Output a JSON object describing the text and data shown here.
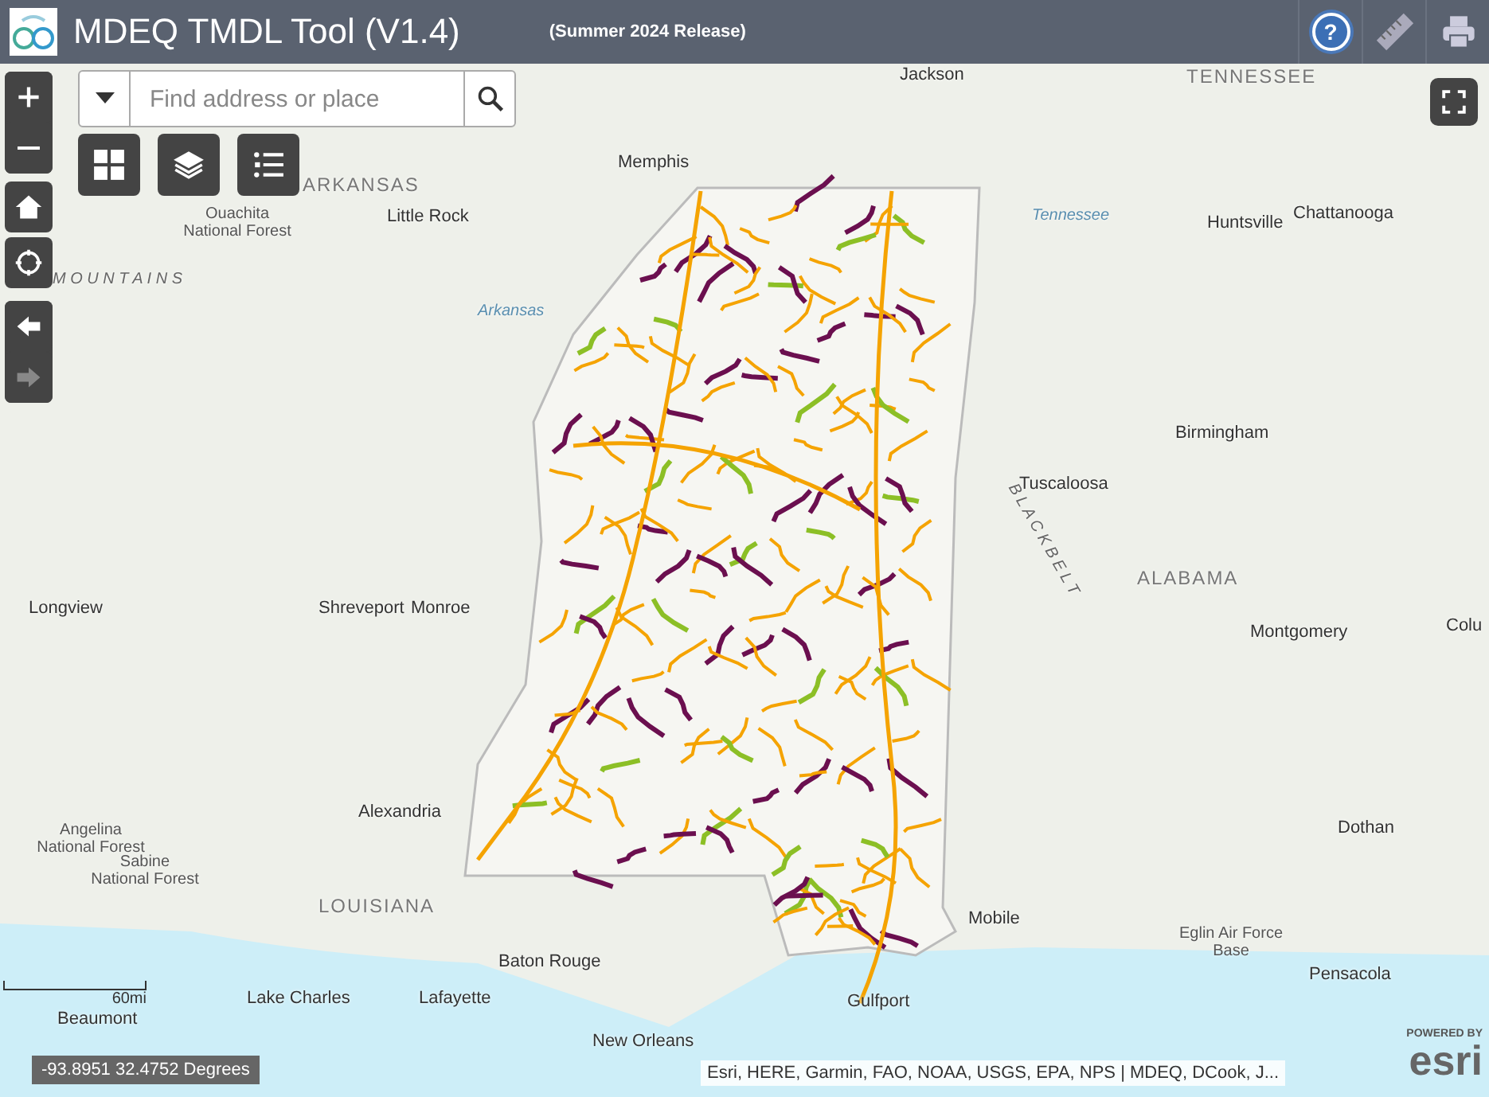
{
  "header": {
    "title": "MDEQ TMDL Tool (V1.4)",
    "subtitle": "(Summer 2024 Release)",
    "help_glyph": "?"
  },
  "search": {
    "placeholder": "Find address or place"
  },
  "map_labels": [
    {
      "text": "Jackson",
      "kind": "city"
    },
    {
      "text": "TENNESSEE",
      "kind": "state"
    },
    {
      "text": "Memphis",
      "kind": "city"
    },
    {
      "text": "ARKANSAS",
      "kind": "state"
    },
    {
      "text": "Ouachita National Forest",
      "kind": "park"
    },
    {
      "text": "Little Rock",
      "kind": "city"
    },
    {
      "text": "Tennessee",
      "kind": "water"
    },
    {
      "text": "Huntsville",
      "kind": "city"
    },
    {
      "text": "Chattanooga",
      "kind": "city"
    },
    {
      "text": "M O U N T A I N S",
      "kind": "region"
    },
    {
      "text": "Arkansas",
      "kind": "water"
    },
    {
      "text": "Birmingham",
      "kind": "city"
    },
    {
      "text": "Tuscaloosa",
      "kind": "city"
    },
    {
      "text": "B L A C K  B E L T",
      "kind": "region"
    },
    {
      "text": "ALABAMA",
      "kind": "state"
    },
    {
      "text": "Longview",
      "kind": "city"
    },
    {
      "text": "Shreveport",
      "kind": "city"
    },
    {
      "text": "Monroe",
      "kind": "city"
    },
    {
      "text": "Montgomery",
      "kind": "city"
    },
    {
      "text": "Colu",
      "kind": "city"
    },
    {
      "text": "Alexandria",
      "kind": "city"
    },
    {
      "text": "Dothan",
      "kind": "city"
    },
    {
      "text": "Angelina National Forest",
      "kind": "park"
    },
    {
      "text": "Sabine National Forest",
      "kind": "park"
    },
    {
      "text": "LOUISIANA",
      "kind": "state"
    },
    {
      "text": "Mobile",
      "kind": "city"
    },
    {
      "text": "Eglin Air Force Base",
      "kind": "park"
    },
    {
      "text": "Baton Rouge",
      "kind": "city"
    },
    {
      "text": "Pensacola",
      "kind": "city"
    },
    {
      "text": "Lake Charles",
      "kind": "city"
    },
    {
      "text": "Lafayette",
      "kind": "city"
    },
    {
      "text": "Gulfport",
      "kind": "city"
    },
    {
      "text": "Beaumont",
      "kind": "city"
    },
    {
      "text": "New Orleans",
      "kind": "city"
    }
  ],
  "scale": {
    "label": "60mi"
  },
  "coordinates": "-93.8951 32.4752 Degrees",
  "attribution": "Esri, HERE, Garmin, FAO, NOAA, USGS, EPA, NPS | MDEQ, DCook, J...",
  "logo": {
    "caption": "POWERED BY",
    "wordmark": "esri"
  }
}
